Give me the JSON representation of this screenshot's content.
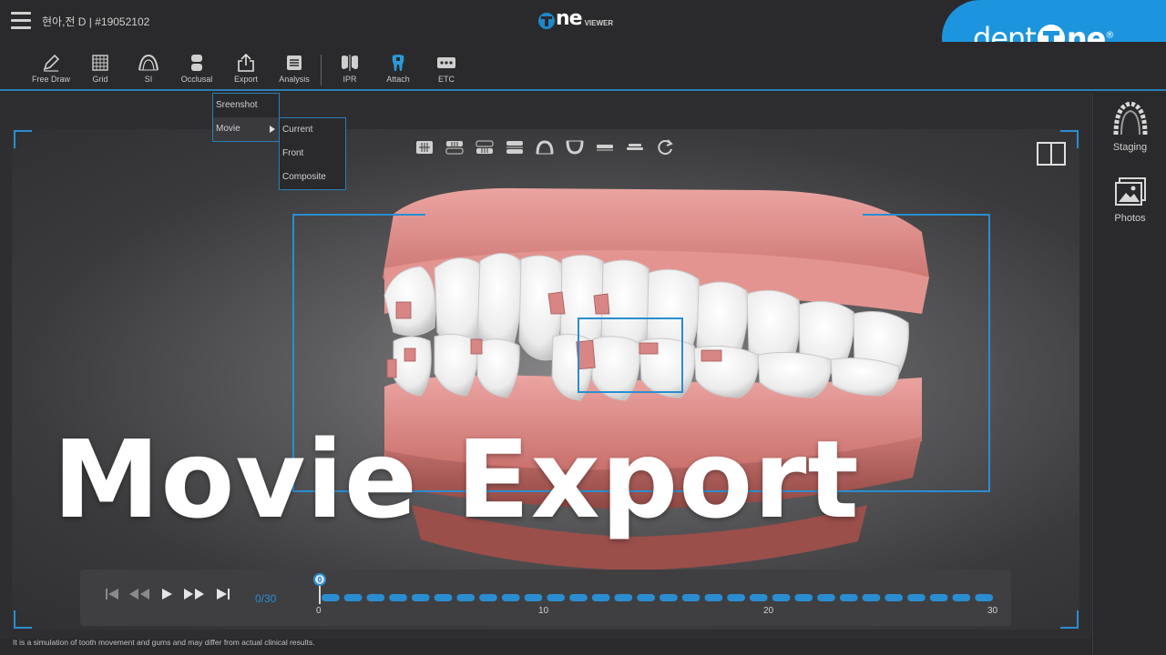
{
  "header": {
    "patient": "현아,전 D | #19052102",
    "viewer_logo_main": "ne",
    "viewer_logo_sub": "VIEWER",
    "brand_prefix": "dent",
    "brand_suffix": "ne"
  },
  "toolbar": {
    "items": [
      {
        "label": "Free Draw",
        "icon": "pencil-icon"
      },
      {
        "label": "Grid",
        "icon": "grid-icon"
      },
      {
        "label": "SI",
        "icon": "si-arch-icon"
      },
      {
        "label": "Occlusal",
        "icon": "occlusal-icon"
      },
      {
        "label": "Export",
        "icon": "export-icon"
      },
      {
        "label": "Analysis",
        "icon": "analysis-icon"
      },
      {
        "label": "IPR",
        "icon": "ipr-icon"
      },
      {
        "label": "Attach",
        "icon": "tooth-attach-icon"
      },
      {
        "label": "ETC",
        "icon": "more-icon"
      }
    ]
  },
  "export_menu": {
    "items": [
      "Sreenshot",
      "Movie"
    ],
    "movie_submenu": [
      "Current",
      "Front",
      "Composite"
    ]
  },
  "sidebar": {
    "items": [
      {
        "label": "Staging",
        "icon": "arch-staging-icon"
      },
      {
        "label": "Photos",
        "icon": "photos-icon"
      }
    ]
  },
  "view_controls": [
    "front-view-icon",
    "upper-front-icon",
    "lower-front-icon",
    "bite-view-icon",
    "upper-arch-icon",
    "lower-arch-icon",
    "side-upper-icon",
    "side-lower-icon",
    "rotate-icon"
  ],
  "headline": "Movie Export",
  "playback": {
    "frame_counter": "0/30",
    "current_frame": "0",
    "ticks": [
      "0",
      "10",
      "20",
      "30"
    ],
    "total_steps": 30,
    "current_step": 0
  },
  "colors": {
    "accent": "#2a8dd0",
    "brand": "#1d95de",
    "gum": "#e89a98",
    "tooth": "#f2f2f2"
  },
  "disclaimer": "It is a simulation of tooth movement and gums and may differ from actual clinical results."
}
